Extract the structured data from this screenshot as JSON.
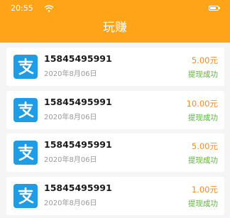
{
  "status_bar": {
    "time": "20:55"
  },
  "header": {
    "title": "玩赚"
  },
  "records": [
    {
      "account": "15845495991",
      "date": "2020年8月06日",
      "amount": "5.00元",
      "status": "提现成功"
    },
    {
      "account": "15845495991",
      "date": "2020年8月06日",
      "amount": "10.00元",
      "status": "提现成功"
    },
    {
      "account": "15845495991",
      "date": "2020年8月06日",
      "amount": "5.00元",
      "status": "提现成功"
    },
    {
      "account": "15845495991",
      "date": "2020年8月06日",
      "amount": "1.00元",
      "status": "提现成功"
    }
  ],
  "icons": {
    "status": [
      "wifi-icon",
      "battery-icon"
    ],
    "record": "alipay-logo-icon"
  },
  "colors": {
    "header": "#ffa317",
    "amount": "#ff8a1c",
    "status": "#5fb23f",
    "alipay": "#1e9ce6"
  }
}
